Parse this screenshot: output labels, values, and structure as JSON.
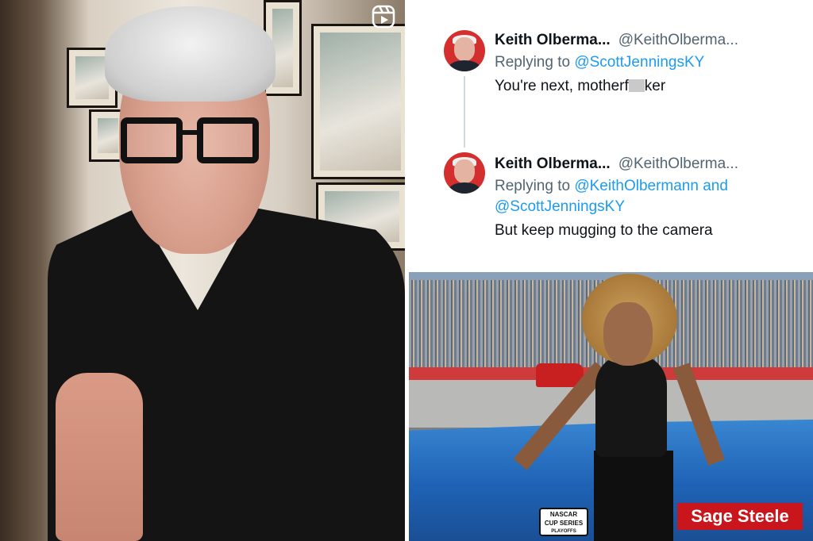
{
  "tweets": [
    {
      "name": "Keith Olberma...",
      "handle": "@KeithOlberma...",
      "reply_prefix": "Replying to",
      "reply_mentions_line1": "@ScottJenningsKY",
      "reply_mentions_line2": "",
      "text_before_censor": "You're next, motherf",
      "text_after_censor": "ker"
    },
    {
      "name": "Keith Olberma...",
      "handle": "@KeithOlberma...",
      "reply_prefix": "Replying to",
      "reply_mentions_line1": "@KeithOlbermann and",
      "reply_mentions_line2": "@ScottJenningsKY",
      "text": "But keep mugging to the camera"
    }
  ],
  "photo_right": {
    "caption": "Sage Steele",
    "nascar_logo_line1": "NASCAR",
    "nascar_logo_line2": "CUP SERIES",
    "nascar_logo_line3": "PLAYOFFS"
  },
  "colors": {
    "mention": "#1d9bf0",
    "caption_bg": "#c8161c",
    "avatar_bg": "#d32f2f"
  },
  "icons": {
    "reels": "instagram-reels-icon"
  }
}
